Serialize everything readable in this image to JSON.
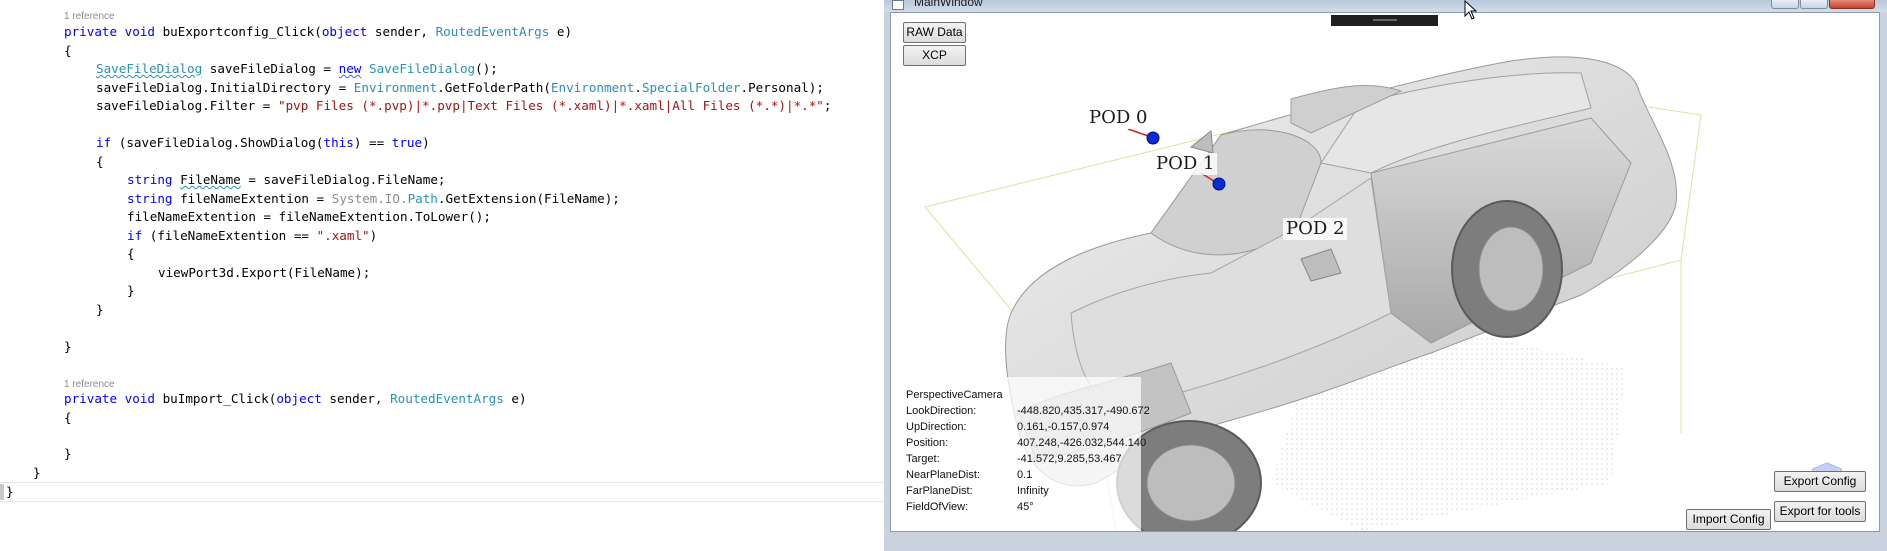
{
  "editor": {
    "ref1": "1 reference",
    "ref2": "1 reference",
    "code": {
      "m1_private": "private",
      "m1_void": "void",
      "m1_name": " buExportconfig_Click(",
      "m1_object": "object",
      "m1_sender": " sender, ",
      "m1_argtype": "RoutedEventArgs",
      "m1_e": " e)",
      "brace_open": "{",
      "brace_close": "}",
      "l3_type": "SaveFileDialog",
      "l3_mid": " saveFileDialog = ",
      "l3_new": "new",
      "l3_sp": " ",
      "l3_type2": "SaveFileDialog",
      "l3_end": "();",
      "l4_a": "saveFileDialog.InitialDirectory = ",
      "l4_env": "Environment",
      "l4_b": ".GetFolderPath(",
      "l4_env2": "Environment",
      "l4_dot": ".",
      "l4_sf": "SpecialFolder",
      "l4_c": ".Personal);",
      "l5_a": "saveFileDialog.Filter = ",
      "l5_str": "\"pvp Files (*.pvp)|*.pvp|Text Files (*.xaml)|*.xaml|All Files (*.*)|*.*\"",
      "l5_end": ";",
      "l7_if": "if",
      "l7_a": " (saveFileDialog.ShowDialog(",
      "l7_this": "this",
      "l7_b": ") == ",
      "l7_true": "true",
      "l7_c": ")",
      "l9_string": "string",
      "l9_sp": " ",
      "l9_var": "FileName",
      "l9_rest": " = saveFileDialog.FileName;",
      "l10_string": "string",
      "l10_a": " fileNameExtention = ",
      "l10_dim": "System.IO.",
      "l10_path": "Path",
      "l10_b": ".GetExtension(FileName);",
      "l11": "fileNameExtention = fileNameExtention.ToLower();",
      "l12_if": "if",
      "l12_a": " (fileNameExtention == ",
      "l12_str": "\".xaml\"",
      "l12_b": ")",
      "l14": "viewPort3d.Export(FileName);",
      "m2_private": "private",
      "m2_void": "void",
      "m2_name": " buImport_Click(",
      "m2_object": "object",
      "m2_sender": " sender, ",
      "m2_argtype": "RoutedEventArgs",
      "m2_e": " e)"
    },
    "colors": {
      "keyword": "#0000ff",
      "type": "#2b91af",
      "string": "#a31515",
      "comment": "#8c8c8c"
    }
  },
  "window": {
    "title": "MainWindow",
    "buttons": {
      "raw_data": "RAW Data",
      "xcp": "XCP",
      "export_config": "Export Config",
      "import_config": "Import Config",
      "export_tools": "Export for tools"
    },
    "pods": [
      "POD 0",
      "POD 1",
      "POD 2"
    ],
    "camera": {
      "type": "PerspectiveCamera",
      "rows": [
        {
          "label": "LookDirection:",
          "value": "-448.820,435.317,-490.672"
        },
        {
          "label": "UpDirection:",
          "value": "0.161,-0.157,0.974"
        },
        {
          "label": "Position:",
          "value": "407.248,-426.032,544.140"
        },
        {
          "label": "Target:",
          "value": "-41.572,9.285,53.467"
        },
        {
          "label": "NearPlaneDist:",
          "value": "0.1"
        },
        {
          "label": "FarPlaneDist:",
          "value": "Infinity"
        },
        {
          "label": "FieldOfView:",
          "value": "45°"
        }
      ]
    }
  }
}
